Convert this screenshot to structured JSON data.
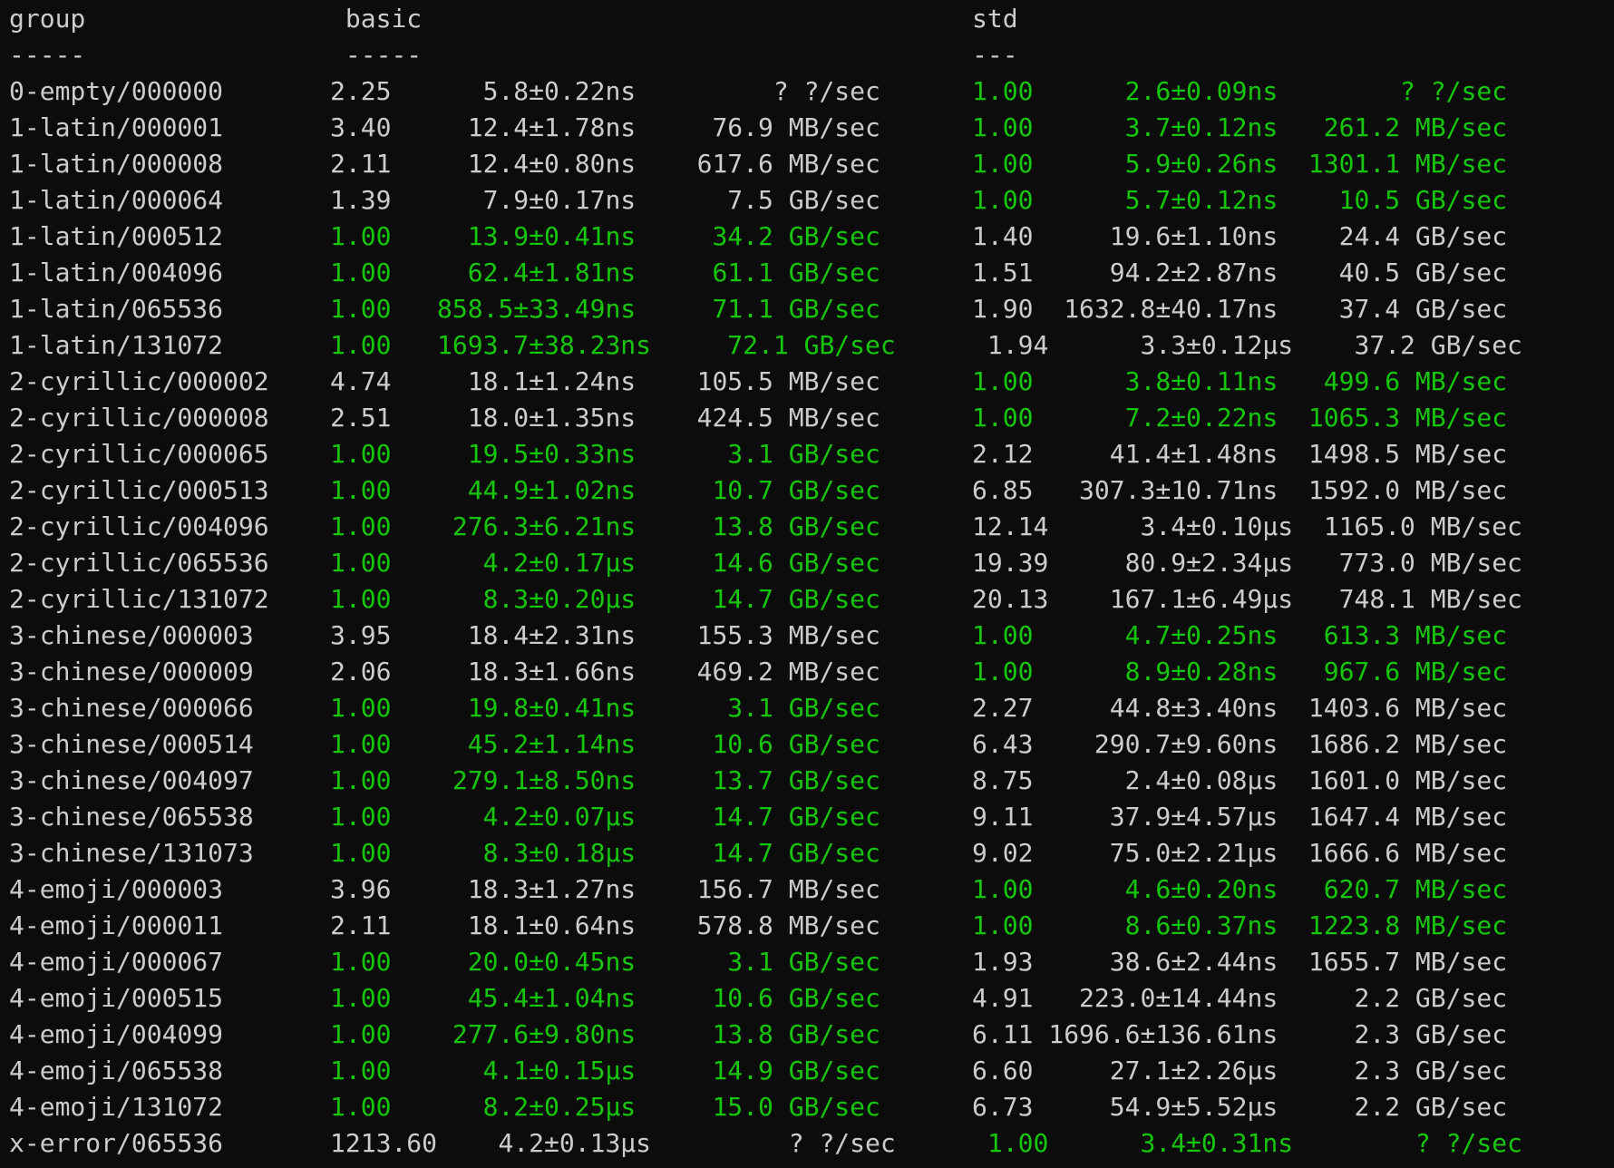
{
  "colors": {
    "background": "#0c0c0c",
    "text": "#cccccc",
    "best": "#16c60c"
  },
  "header": {
    "group": "group",
    "basic": "basic",
    "std": "std",
    "group_rule": "-----",
    "basic_rule": "-----",
    "std_rule": "---"
  },
  "rows": [
    {
      "group": "0-empty/000000",
      "basic": {
        "ratio": "2.25",
        "time": "5.8±0.22ns",
        "thr": "? ?/sec",
        "best": false
      },
      "std": {
        "ratio": "1.00",
        "time": "2.6±0.09ns",
        "thr": "? ?/sec",
        "best": true
      }
    },
    {
      "group": "1-latin/000001",
      "basic": {
        "ratio": "3.40",
        "time": "12.4±1.78ns",
        "thr": "76.9 MB/sec",
        "best": false
      },
      "std": {
        "ratio": "1.00",
        "time": "3.7±0.12ns",
        "thr": "261.2 MB/sec",
        "best": true
      }
    },
    {
      "group": "1-latin/000008",
      "basic": {
        "ratio": "2.11",
        "time": "12.4±0.80ns",
        "thr": "617.6 MB/sec",
        "best": false
      },
      "std": {
        "ratio": "1.00",
        "time": "5.9±0.26ns",
        "thr": "1301.1 MB/sec",
        "best": true
      }
    },
    {
      "group": "1-latin/000064",
      "basic": {
        "ratio": "1.39",
        "time": "7.9±0.17ns",
        "thr": "7.5 GB/sec",
        "best": false
      },
      "std": {
        "ratio": "1.00",
        "time": "5.7±0.12ns",
        "thr": "10.5 GB/sec",
        "best": true
      }
    },
    {
      "group": "1-latin/000512",
      "basic": {
        "ratio": "1.00",
        "time": "13.9±0.41ns",
        "thr": "34.2 GB/sec",
        "best": true
      },
      "std": {
        "ratio": "1.40",
        "time": "19.6±1.10ns",
        "thr": "24.4 GB/sec",
        "best": false
      }
    },
    {
      "group": "1-latin/004096",
      "basic": {
        "ratio": "1.00",
        "time": "62.4±1.81ns",
        "thr": "61.1 GB/sec",
        "best": true
      },
      "std": {
        "ratio": "1.51",
        "time": "94.2±2.87ns",
        "thr": "40.5 GB/sec",
        "best": false
      }
    },
    {
      "group": "1-latin/065536",
      "basic": {
        "ratio": "1.00",
        "time": "858.5±33.49ns",
        "thr": "71.1 GB/sec",
        "best": true
      },
      "std": {
        "ratio": "1.90",
        "time": "1632.8±40.17ns",
        "thr": "37.4 GB/sec",
        "best": false
      }
    },
    {
      "group": "1-latin/131072",
      "basic": {
        "ratio": "1.00",
        "time": "1693.7±38.23ns",
        "thr": "72.1 GB/sec",
        "best": true
      },
      "std": {
        "ratio": "1.94",
        "time": "3.3±0.12µs",
        "thr": "37.2 GB/sec",
        "best": false
      }
    },
    {
      "group": "2-cyrillic/000002",
      "basic": {
        "ratio": "4.74",
        "time": "18.1±1.24ns",
        "thr": "105.5 MB/sec",
        "best": false
      },
      "std": {
        "ratio": "1.00",
        "time": "3.8±0.11ns",
        "thr": "499.6 MB/sec",
        "best": true
      }
    },
    {
      "group": "2-cyrillic/000008",
      "basic": {
        "ratio": "2.51",
        "time": "18.0±1.35ns",
        "thr": "424.5 MB/sec",
        "best": false
      },
      "std": {
        "ratio": "1.00",
        "time": "7.2±0.22ns",
        "thr": "1065.3 MB/sec",
        "best": true
      }
    },
    {
      "group": "2-cyrillic/000065",
      "basic": {
        "ratio": "1.00",
        "time": "19.5±0.33ns",
        "thr": "3.1 GB/sec",
        "best": true
      },
      "std": {
        "ratio": "2.12",
        "time": "41.4±1.48ns",
        "thr": "1498.5 MB/sec",
        "best": false
      }
    },
    {
      "group": "2-cyrillic/000513",
      "basic": {
        "ratio": "1.00",
        "time": "44.9±1.02ns",
        "thr": "10.7 GB/sec",
        "best": true
      },
      "std": {
        "ratio": "6.85",
        "time": "307.3±10.71ns",
        "thr": "1592.0 MB/sec",
        "best": false
      }
    },
    {
      "group": "2-cyrillic/004096",
      "basic": {
        "ratio": "1.00",
        "time": "276.3±6.21ns",
        "thr": "13.8 GB/sec",
        "best": true
      },
      "std": {
        "ratio": "12.14",
        "time": "3.4±0.10µs",
        "thr": "1165.0 MB/sec",
        "best": false
      }
    },
    {
      "group": "2-cyrillic/065536",
      "basic": {
        "ratio": "1.00",
        "time": "4.2±0.17µs",
        "thr": "14.6 GB/sec",
        "best": true
      },
      "std": {
        "ratio": "19.39",
        "time": "80.9±2.34µs",
        "thr": "773.0 MB/sec",
        "best": false
      }
    },
    {
      "group": "2-cyrillic/131072",
      "basic": {
        "ratio": "1.00",
        "time": "8.3±0.20µs",
        "thr": "14.7 GB/sec",
        "best": true
      },
      "std": {
        "ratio": "20.13",
        "time": "167.1±6.49µs",
        "thr": "748.1 MB/sec",
        "best": false
      }
    },
    {
      "group": "3-chinese/000003",
      "basic": {
        "ratio": "3.95",
        "time": "18.4±2.31ns",
        "thr": "155.3 MB/sec",
        "best": false
      },
      "std": {
        "ratio": "1.00",
        "time": "4.7±0.25ns",
        "thr": "613.3 MB/sec",
        "best": true
      }
    },
    {
      "group": "3-chinese/000009",
      "basic": {
        "ratio": "2.06",
        "time": "18.3±1.66ns",
        "thr": "469.2 MB/sec",
        "best": false
      },
      "std": {
        "ratio": "1.00",
        "time": "8.9±0.28ns",
        "thr": "967.6 MB/sec",
        "best": true
      }
    },
    {
      "group": "3-chinese/000066",
      "basic": {
        "ratio": "1.00",
        "time": "19.8±0.41ns",
        "thr": "3.1 GB/sec",
        "best": true
      },
      "std": {
        "ratio": "2.27",
        "time": "44.8±3.40ns",
        "thr": "1403.6 MB/sec",
        "best": false
      }
    },
    {
      "group": "3-chinese/000514",
      "basic": {
        "ratio": "1.00",
        "time": "45.2±1.14ns",
        "thr": "10.6 GB/sec",
        "best": true
      },
      "std": {
        "ratio": "6.43",
        "time": "290.7±9.60ns",
        "thr": "1686.2 MB/sec",
        "best": false
      }
    },
    {
      "group": "3-chinese/004097",
      "basic": {
        "ratio": "1.00",
        "time": "279.1±8.50ns",
        "thr": "13.7 GB/sec",
        "best": true
      },
      "std": {
        "ratio": "8.75",
        "time": "2.4±0.08µs",
        "thr": "1601.0 MB/sec",
        "best": false
      }
    },
    {
      "group": "3-chinese/065538",
      "basic": {
        "ratio": "1.00",
        "time": "4.2±0.07µs",
        "thr": "14.7 GB/sec",
        "best": true
      },
      "std": {
        "ratio": "9.11",
        "time": "37.9±4.57µs",
        "thr": "1647.4 MB/sec",
        "best": false
      }
    },
    {
      "group": "3-chinese/131073",
      "basic": {
        "ratio": "1.00",
        "time": "8.3±0.18µs",
        "thr": "14.7 GB/sec",
        "best": true
      },
      "std": {
        "ratio": "9.02",
        "time": "75.0±2.21µs",
        "thr": "1666.6 MB/sec",
        "best": false
      }
    },
    {
      "group": "4-emoji/000003",
      "basic": {
        "ratio": "3.96",
        "time": "18.3±1.27ns",
        "thr": "156.7 MB/sec",
        "best": false
      },
      "std": {
        "ratio": "1.00",
        "time": "4.6±0.20ns",
        "thr": "620.7 MB/sec",
        "best": true
      }
    },
    {
      "group": "4-emoji/000011",
      "basic": {
        "ratio": "2.11",
        "time": "18.1±0.64ns",
        "thr": "578.8 MB/sec",
        "best": false
      },
      "std": {
        "ratio": "1.00",
        "time": "8.6±0.37ns",
        "thr": "1223.8 MB/sec",
        "best": true
      }
    },
    {
      "group": "4-emoji/000067",
      "basic": {
        "ratio": "1.00",
        "time": "20.0±0.45ns",
        "thr": "3.1 GB/sec",
        "best": true
      },
      "std": {
        "ratio": "1.93",
        "time": "38.6±2.44ns",
        "thr": "1655.7 MB/sec",
        "best": false
      }
    },
    {
      "group": "4-emoji/000515",
      "basic": {
        "ratio": "1.00",
        "time": "45.4±1.04ns",
        "thr": "10.6 GB/sec",
        "best": true
      },
      "std": {
        "ratio": "4.91",
        "time": "223.0±14.44ns",
        "thr": "2.2 GB/sec",
        "best": false
      }
    },
    {
      "group": "4-emoji/004099",
      "basic": {
        "ratio": "1.00",
        "time": "277.6±9.80ns",
        "thr": "13.8 GB/sec",
        "best": true
      },
      "std": {
        "ratio": "6.11",
        "time": "1696.6±136.61ns",
        "thr": "2.3 GB/sec",
        "best": false
      }
    },
    {
      "group": "4-emoji/065538",
      "basic": {
        "ratio": "1.00",
        "time": "4.1±0.15µs",
        "thr": "14.9 GB/sec",
        "best": true
      },
      "std": {
        "ratio": "6.60",
        "time": "27.1±2.26µs",
        "thr": "2.3 GB/sec",
        "best": false
      }
    },
    {
      "group": "4-emoji/131072",
      "basic": {
        "ratio": "1.00",
        "time": "8.2±0.25µs",
        "thr": "15.0 GB/sec",
        "best": true
      },
      "std": {
        "ratio": "6.73",
        "time": "54.9±5.52µs",
        "thr": "2.2 GB/sec",
        "best": false
      }
    },
    {
      "group": "x-error/065536",
      "basic": {
        "ratio": "1213.60",
        "time": "4.2±0.13µs",
        "thr": "? ?/sec",
        "best": false
      },
      "std": {
        "ratio": "1.00",
        "time": "3.4±0.31ns",
        "thr": "? ?/sec",
        "best": true
      }
    }
  ]
}
